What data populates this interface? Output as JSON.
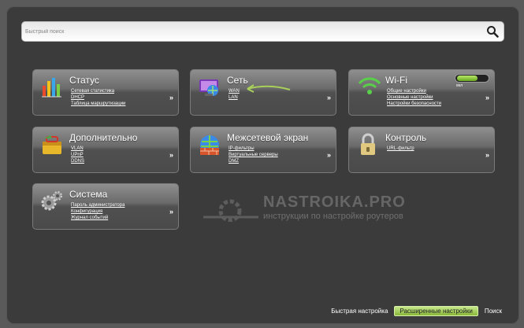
{
  "search": {
    "placeholder": "Быстрый поиск"
  },
  "tiles": {
    "status": {
      "title": "Статус",
      "links": [
        "Сетевая статистика",
        "DHCP",
        "Таблица маршрутизации"
      ],
      "more": "»"
    },
    "network": {
      "title": "Сеть",
      "links": [
        "WAN",
        "LAN"
      ],
      "more": "»"
    },
    "wifi": {
      "title": "Wi-Fi",
      "links": [
        "Общие настройки",
        "Основные настройки",
        "Настройки безопасности"
      ],
      "more": "»",
      "toggle_label": "вкл",
      "toggle_on": true
    },
    "additional": {
      "title": "Дополнительно",
      "links": [
        "VLAN",
        "UPnP",
        "DDNS"
      ],
      "more": "»"
    },
    "firewall": {
      "title": "Межсетевой экран",
      "links": [
        "IP-фильтры",
        "Виртуальные серверы",
        "DMZ"
      ],
      "more": "»"
    },
    "control": {
      "title": "Контроль",
      "links": [
        "URL-фильтр"
      ],
      "more": "»"
    },
    "system": {
      "title": "Система",
      "links": [
        "Пароль администратора",
        "Конфигурация",
        "Журнал событий"
      ],
      "more": "»"
    }
  },
  "watermark": {
    "title": "NASTROIKA.PRO",
    "subtitle": "инструкции по настройке роутеров"
  },
  "footer": {
    "quick_setup": "Быстрая настройка",
    "advanced": "Расширенные настройки",
    "search": "Поиск"
  },
  "colors": {
    "accent_green": "#8ab83a",
    "tile_top": "#8f8f8f",
    "tile_bottom": "#4a4a4a",
    "frame": "#3b3b3b"
  }
}
